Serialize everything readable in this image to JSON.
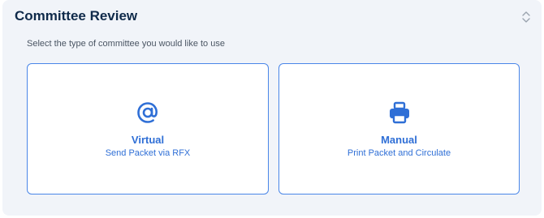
{
  "panel": {
    "title": "Committee Review",
    "subtitle": "Select the type of committee you would like to use",
    "toggle_icon": "chevron-up-down-icon"
  },
  "options": [
    {
      "title": "Virtual",
      "description": "Send Packet via RFX",
      "icon": "at-sign-icon"
    },
    {
      "title": "Manual",
      "description": "Print Packet and Circulate",
      "icon": "printer-icon"
    }
  ],
  "colors": {
    "accent": "#2f6fd6",
    "card_border": "#4a86e8",
    "panel_bg": "#f1f4f9",
    "title_text": "#0f2a4a"
  }
}
